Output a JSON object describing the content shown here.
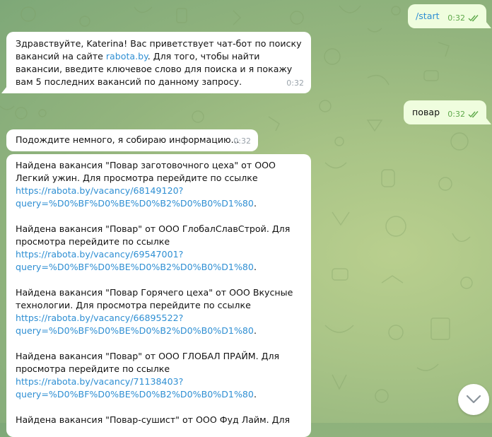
{
  "messages": {
    "start_cmd": {
      "text": "/start",
      "time": "0:32"
    },
    "greeting": {
      "text_before": "Здравствуйте, Katerina! Вас приветствует чат-бот по поиску вакансий на сайте ",
      "link": "rabota.by",
      "text_after": ". Для того, чтобы найти вакансии, введите ключевое слово для поиска и я покажу вам 5 последних вакансий по данному запросу.",
      "time": "0:32"
    },
    "query": {
      "text": "повар",
      "time": "0:32"
    },
    "wait": {
      "text": "Подождите немного, я собираю информацию...",
      "time": "0:32"
    },
    "results": [
      {
        "text": "Найдена вакансия \"Повар заготовочного цеха\" от ООО Легкий ужин. Для просмотра перейдите по ссылке",
        "url1": "https://rabota.by/vacancy/68149120?",
        "url2": "query=%D0%BF%D0%BE%D0%B2%D0%B0%D1%80"
      },
      {
        "text": "Найдена вакансия \"Повар\" от ООО ГлобалСлавСтрой. Для просмотра перейдите по ссылке",
        "url1": "https://rabota.by/vacancy/69547001?",
        "url2": "query=%D0%BF%D0%BE%D0%B2%D0%B0%D1%80"
      },
      {
        "text": "Найдена вакансия \"Повар Горячего цеха\" от ООО Вкусные технологии. Для просмотра перейдите по ссылке",
        "url1": "https://rabota.by/vacancy/66895522?",
        "url2": "query=%D0%BF%D0%BE%D0%B2%D0%B0%D1%80"
      },
      {
        "text": "Найдена вакансия \"Повар\" от ООО ГЛОБАЛ ПРАЙМ. Для просмотра перейдите по ссылке",
        "url1": "https://rabota.by/vacancy/71138403?",
        "url2": "query=%D0%BF%D0%BE%D0%B2%D0%B0%D1%80"
      },
      {
        "text": "Найдена вакансия \"Повар-сушист\" от ООО Фуд Лайм. Для"
      }
    ]
  },
  "icons": {
    "read": "double-check-icon",
    "scroll": "chevron-down-icon"
  },
  "colors": {
    "link": "#2f8fd3",
    "outgoing_bubble": "#effdde",
    "incoming_bubble": "#ffffff",
    "outgoing_time": "#5ea94a"
  }
}
